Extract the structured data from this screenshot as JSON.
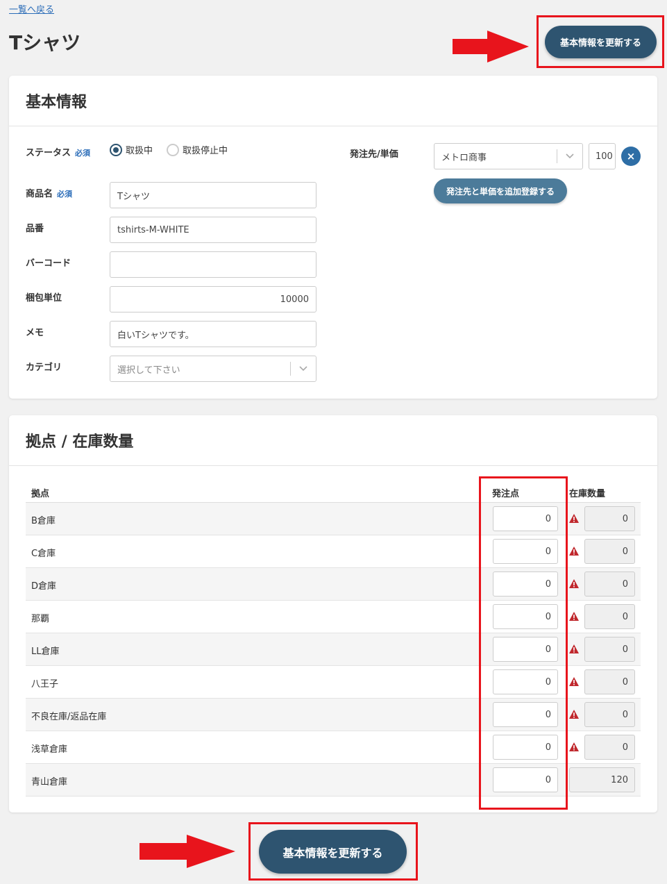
{
  "nav": {
    "back_label": "一覧へ戻る"
  },
  "page": {
    "title": "Tシャツ"
  },
  "actions": {
    "update_label": "基本情報を更新する"
  },
  "basic_info": {
    "heading": "基本情報",
    "status": {
      "label": "ステータス",
      "required_mark": "必須",
      "options": [
        "取扱中",
        "取扱停止中"
      ],
      "selected": "取扱中"
    },
    "product_name": {
      "label": "商品名",
      "required_mark": "必須",
      "value": "Tシャツ"
    },
    "product_code": {
      "label": "品番",
      "value": "tshirts-M-WHITE"
    },
    "barcode": {
      "label": "バーコード",
      "value": ""
    },
    "package_unit": {
      "label": "梱包単位",
      "value": "10000"
    },
    "memo": {
      "label": "メモ",
      "value": "白いTシャツです。"
    },
    "category": {
      "label": "カテゴリ",
      "placeholder": "選択して下さい"
    },
    "supplier": {
      "label": "発注先/単価",
      "selected": "メトロ商事",
      "price": "100",
      "add_button": "発注先と単価を追加登録する",
      "remove_icon": "close-icon"
    }
  },
  "stock": {
    "heading": "拠点 / 在庫数量",
    "columns": {
      "location": "拠点",
      "reorder_point": "発注点",
      "quantity": "在庫数量"
    },
    "rows": [
      {
        "location": "B倉庫",
        "reorder_point": "0",
        "quantity": "0",
        "warning": true
      },
      {
        "location": "C倉庫",
        "reorder_point": "0",
        "quantity": "0",
        "warning": true
      },
      {
        "location": "D倉庫",
        "reorder_point": "0",
        "quantity": "0",
        "warning": true
      },
      {
        "location": "那覇",
        "reorder_point": "0",
        "quantity": "0",
        "warning": true
      },
      {
        "location": "LL倉庫",
        "reorder_point": "0",
        "quantity": "0",
        "warning": true
      },
      {
        "location": "八王子",
        "reorder_point": "0",
        "quantity": "0",
        "warning": true
      },
      {
        "location": "不良在庫/返品在庫",
        "reorder_point": "0",
        "quantity": "0",
        "warning": true
      },
      {
        "location": "浅草倉庫",
        "reorder_point": "0",
        "quantity": "0",
        "warning": true
      },
      {
        "location": "青山倉庫",
        "reorder_point": "0",
        "quantity": "120",
        "warning": false
      }
    ]
  },
  "colors": {
    "primary": "#2e5470",
    "secondary": "#4c7b9a",
    "highlight": "#e8141c",
    "warning": "#c0282d",
    "link": "#2a6cb8"
  }
}
